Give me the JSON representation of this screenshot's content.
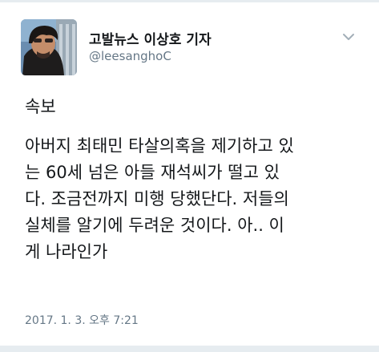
{
  "tweet": {
    "author_name": "고발뉴스 이상호 기자",
    "author_handle": "@leesanghoC",
    "menu_icon": "chevron-down-icon",
    "text_lines": [
      "속보",
      "아버지 최태민 타살의혹을 제기하고 있",
      "는 60세 넘은 아들 재석씨가 떨고 있",
      "다. 조금전까지 미행 당했단다. 저들의",
      "실체를 알기에 두려운 것이다. 아.. 이",
      "게 나라인가"
    ],
    "timestamp": "2017. 1. 3. 오후 7:21"
  },
  "colors": {
    "text_primary": "#14171a",
    "text_secondary": "#657786",
    "divider": "#e6ecf0"
  }
}
